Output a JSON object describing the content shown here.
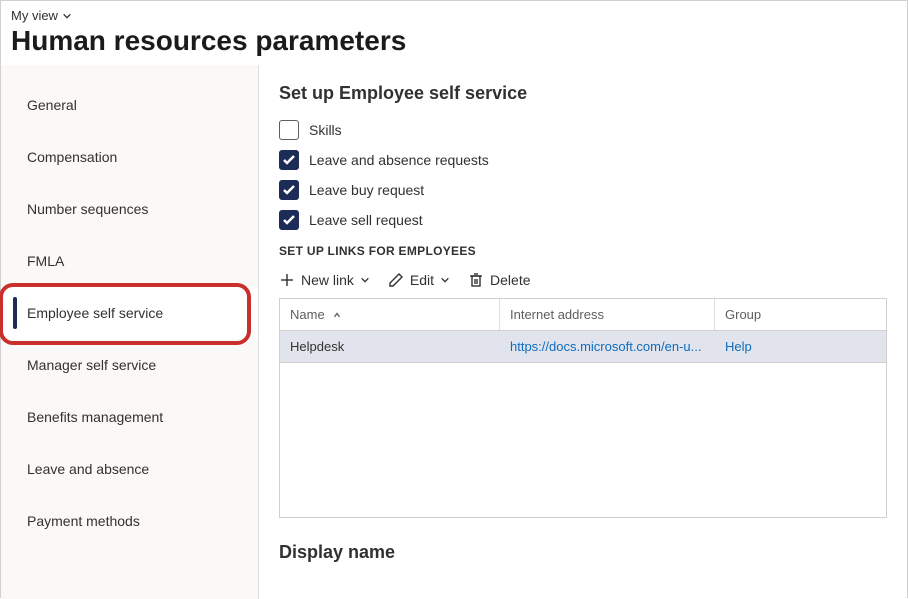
{
  "header": {
    "view_label": "My view",
    "page_title": "Human resources parameters"
  },
  "sidebar": {
    "items": [
      {
        "label": "General",
        "active": false
      },
      {
        "label": "Compensation",
        "active": false
      },
      {
        "label": "Number sequences",
        "active": false
      },
      {
        "label": "FMLA",
        "active": false
      },
      {
        "label": "Employee self service",
        "active": true
      },
      {
        "label": "Manager self service",
        "active": false
      },
      {
        "label": "Benefits management",
        "active": false
      },
      {
        "label": "Leave and absence",
        "active": false
      },
      {
        "label": "Payment methods",
        "active": false
      }
    ]
  },
  "main": {
    "section_title": "Set up Employee self service",
    "checkboxes": [
      {
        "label": "Skills",
        "checked": false
      },
      {
        "label": "Leave and absence requests",
        "checked": true
      },
      {
        "label": "Leave buy request",
        "checked": true
      },
      {
        "label": "Leave sell request",
        "checked": true
      }
    ],
    "links_heading": "SET UP LINKS FOR EMPLOYEES",
    "toolbar": {
      "new_link": "New link",
      "edit": "Edit",
      "delete": "Delete"
    },
    "table": {
      "columns": {
        "name": "Name",
        "address": "Internet address",
        "group": "Group"
      },
      "rows": [
        {
          "name": "Helpdesk",
          "address": "https://docs.microsoft.com/en-u...",
          "group": "Help"
        }
      ]
    },
    "display_name_heading": "Display name"
  }
}
